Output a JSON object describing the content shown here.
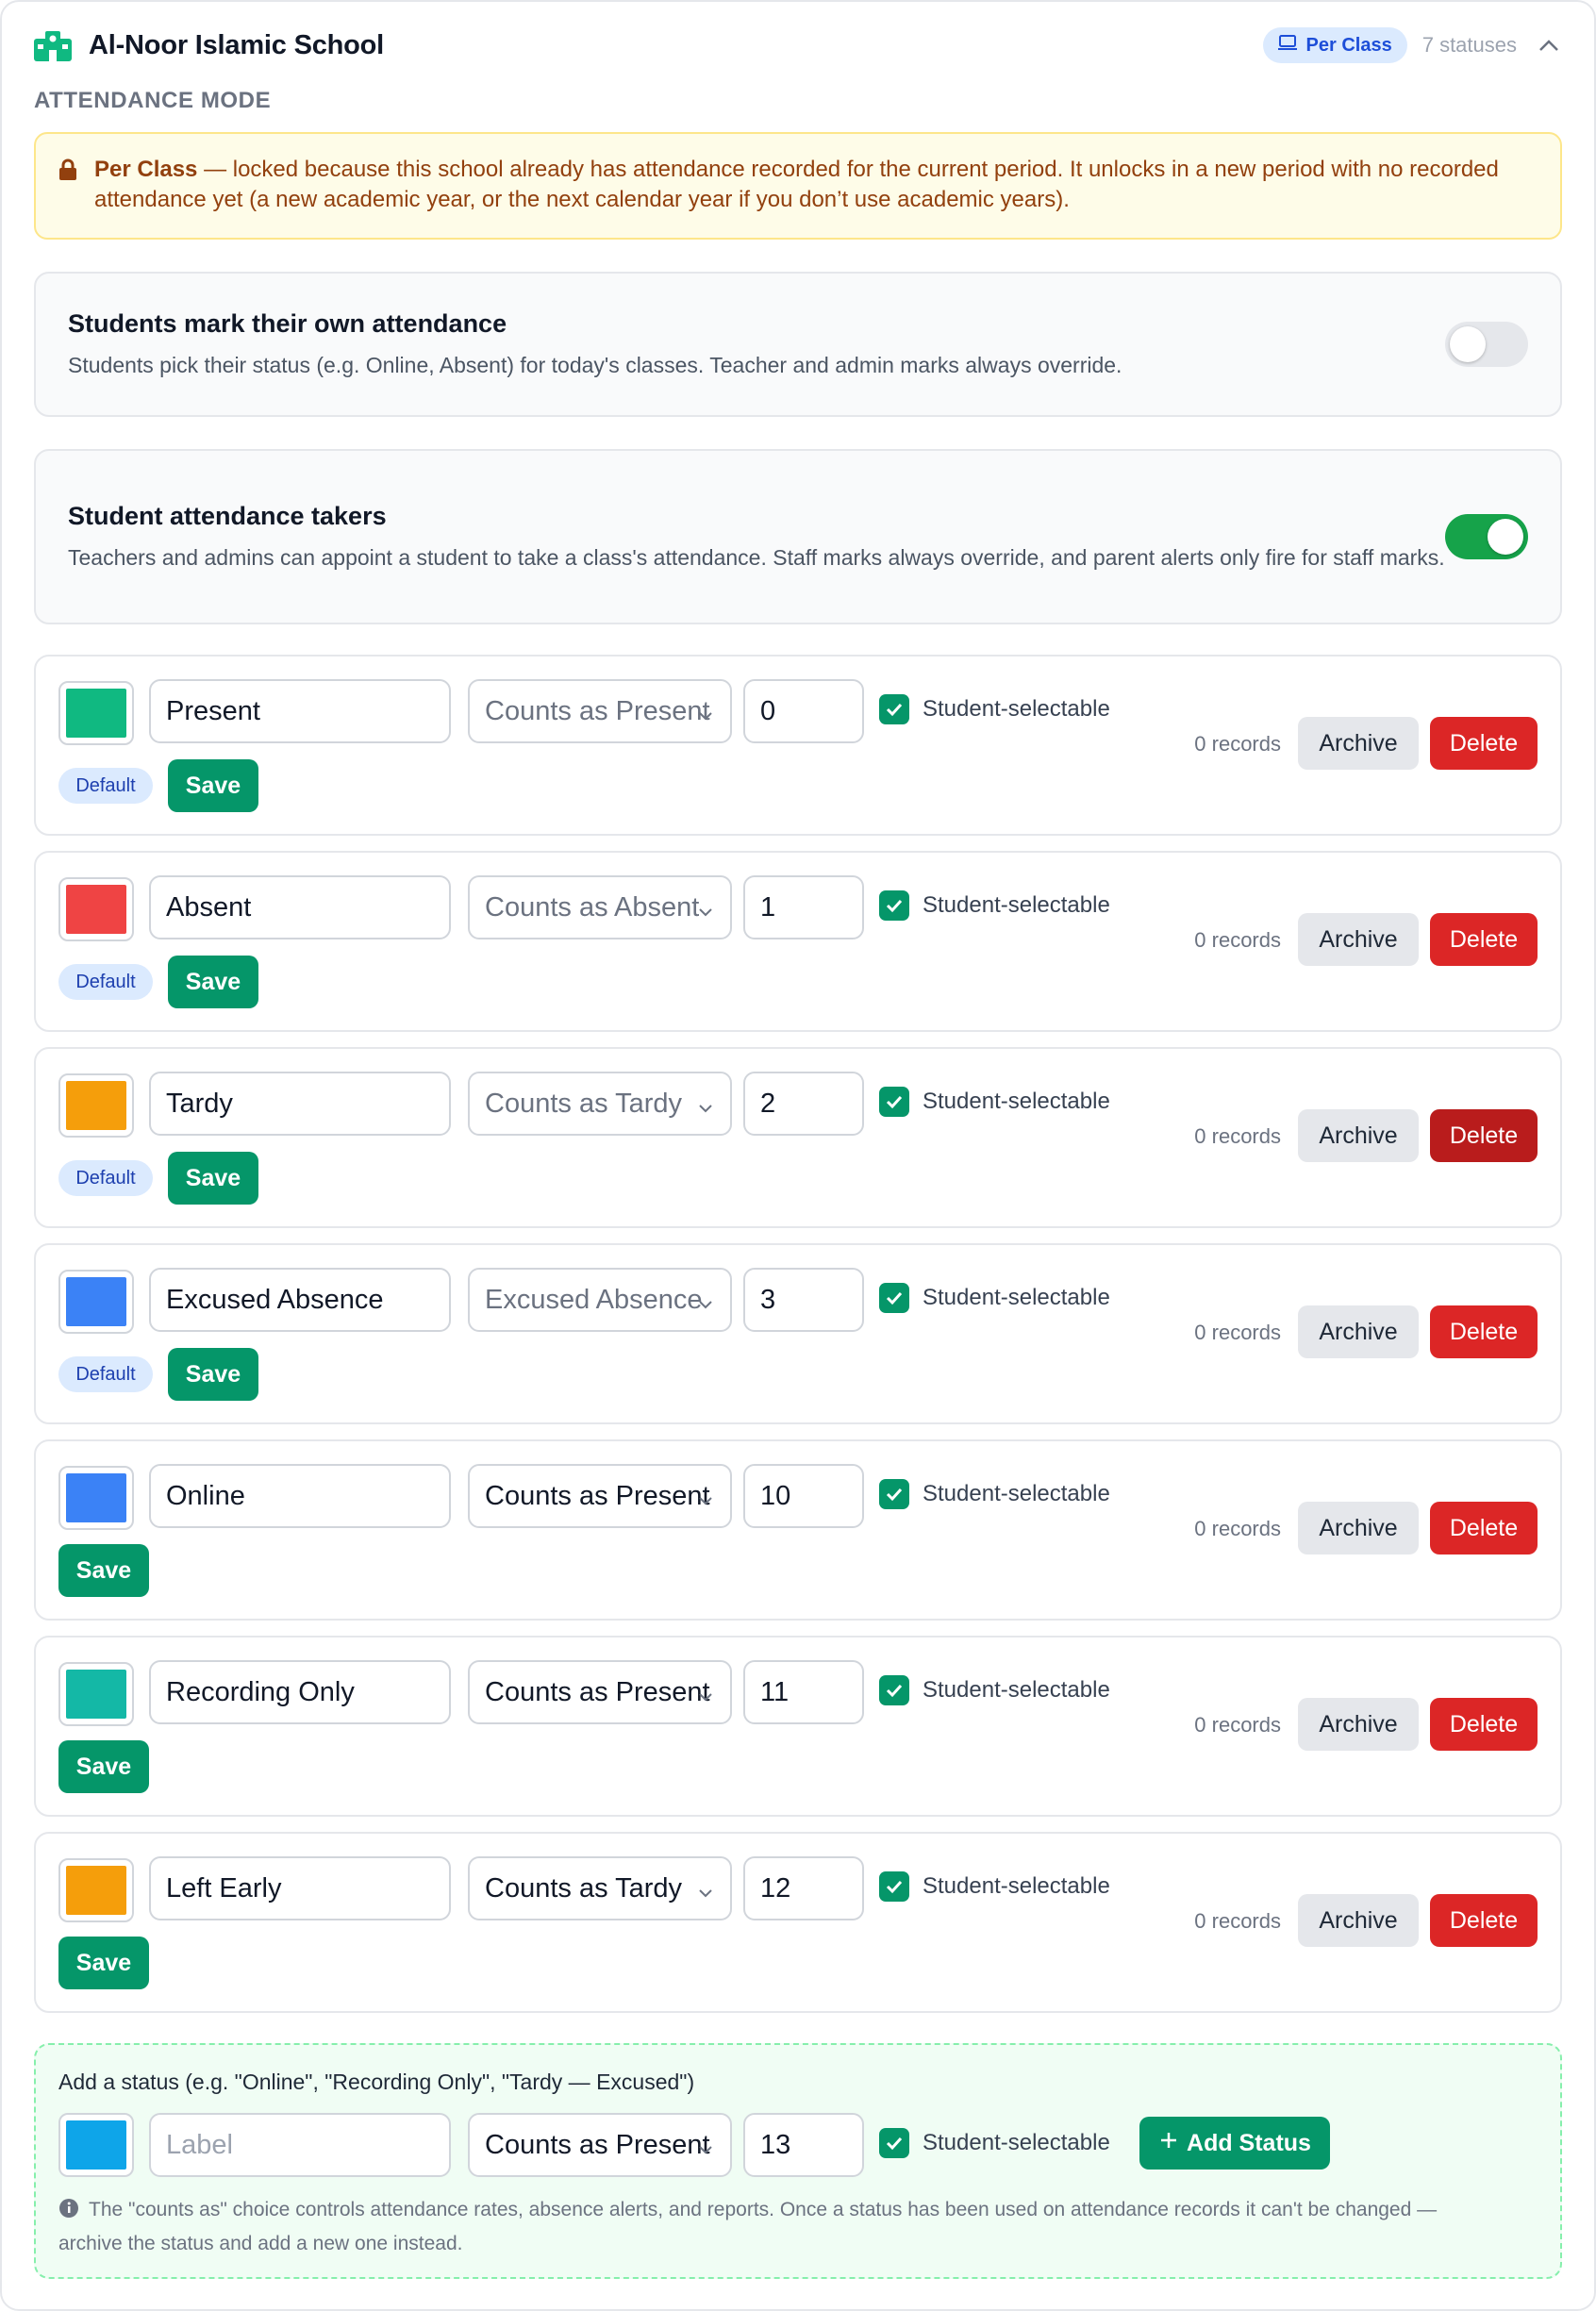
{
  "header": {
    "school_name": "Al-Noor Islamic School",
    "mode_badge": "Per Class",
    "status_count": "7 statuses"
  },
  "section_label": "ATTENDANCE MODE",
  "lock_note": {
    "mode": "Per Class",
    "text": " — locked because this school already has attendance recorded for the current period. It unlocks in a new period with no recorded attendance yet (a new academic year, or the next calendar year if you don’t use academic years)."
  },
  "self_marking": {
    "title": "Students mark their own attendance",
    "description": "Students pick their status (e.g. Online, Absent) for today's classes. Teacher and admin marks always override.",
    "enabled": false
  },
  "attendance_takers": {
    "title": "Student attendance takers",
    "description": "Teachers and admins can appoint a student to take a class's attendance. Staff marks always override, and parent alerts only fire for staff marks.",
    "enabled": true
  },
  "common": {
    "student_selectable_label": "Student-selectable",
    "archive_label": "Archive",
    "delete_label": "Delete",
    "save_label": "Save",
    "default_label": "Default"
  },
  "statuses": [
    {
      "color": "#10b981",
      "label": "Present",
      "counts_as": "Counts as Present",
      "order": "0",
      "student_selectable": true,
      "records": "0 records",
      "is_default": true
    },
    {
      "color": "#ef4444",
      "label": "Absent",
      "counts_as": "Counts as Absent",
      "order": "1",
      "student_selectable": true,
      "records": "0 records",
      "is_default": true
    },
    {
      "color": "#f59e0b",
      "label": "Tardy",
      "counts_as": "Counts as Tardy",
      "order": "2",
      "student_selectable": true,
      "records": "0 records",
      "is_default": true
    },
    {
      "color": "#3b82f6",
      "label": "Excused Absence",
      "counts_as": "Excused Absence",
      "order": "3",
      "student_selectable": true,
      "records": "0 records",
      "is_default": true
    },
    {
      "color": "#3b82f6",
      "label": "Online",
      "counts_as": "Counts as Present",
      "order": "10",
      "student_selectable": true,
      "records": "0 records",
      "is_default": false
    },
    {
      "color": "#14b8a6",
      "label": "Recording Only",
      "counts_as": "Counts as Present",
      "order": "11",
      "student_selectable": true,
      "records": "0 records",
      "is_default": false
    },
    {
      "color": "#f59e0b",
      "label": "Left Early",
      "counts_as": "Counts as Tardy",
      "order": "12",
      "student_selectable": true,
      "records": "0 records",
      "is_default": false
    }
  ],
  "add_status": {
    "title": "Add a status (e.g. \"Online\", \"Recording Only\", \"Tardy — Excused\")",
    "color": "#0ea5e9",
    "label_placeholder": "Label",
    "counts_as": "Counts as Present",
    "order": "13",
    "student_selectable": true,
    "student_selectable_label": "Student-selectable",
    "button_label": "Add Status",
    "info_note": "The \"counts as\" choice controls attendance rates, absence alerts, and reports. Once a status has been used on attendance records it can't be changed — archive the status and add a new one instead."
  },
  "colors": {
    "accent": "#059669",
    "danger": "#dc2626",
    "warning_bg": "#fefce8",
    "info_badge_bg": "#dbeafe"
  },
  "icons": {
    "school": "school-icon",
    "mode": "monitor-icon",
    "collapse": "chevron-up-icon",
    "lock": "lock-icon",
    "check": "check-icon",
    "caret": "chevron-down-icon",
    "add": "plus-icon",
    "info": "info-icon"
  }
}
